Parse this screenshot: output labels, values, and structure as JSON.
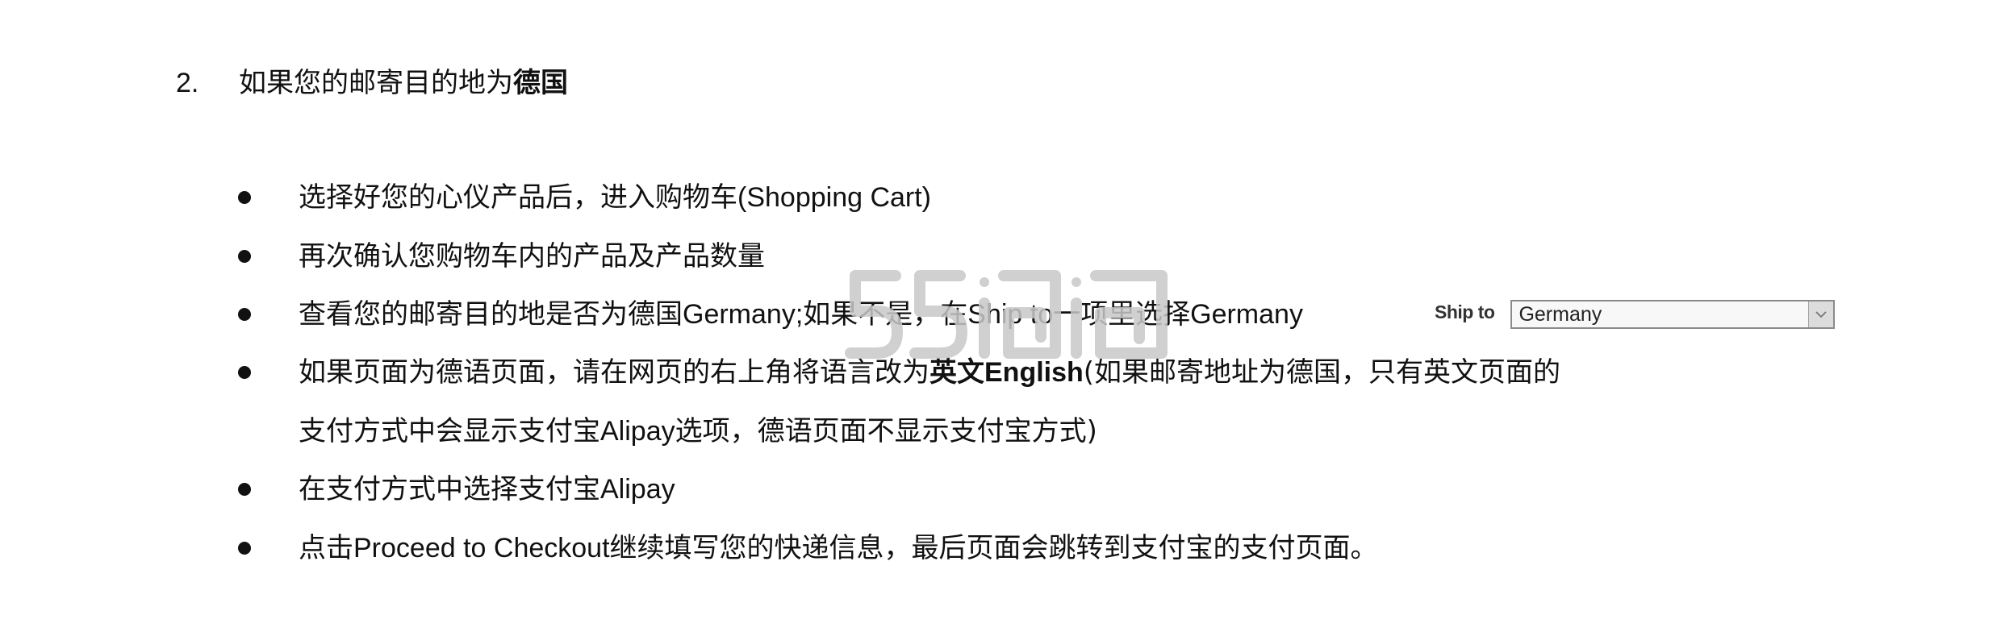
{
  "heading": {
    "number": "2.",
    "text_plain": "如果您的邮寄目的地为",
    "text_bold": "德国"
  },
  "bullets": [
    {
      "segments": [
        {
          "text": "选择好您的心仪产品后，进入购物车",
          "bold": false
        },
        {
          "text": "(Shopping Cart)",
          "bold": false,
          "latin": true
        }
      ]
    },
    {
      "segments": [
        {
          "text": "再次确认您购物车内的产品及产品数量",
          "bold": false
        }
      ]
    },
    {
      "segments": [
        {
          "text": "查看您的邮寄目的地是否为德国 ",
          "bold": false
        },
        {
          "text": "Germany;",
          "bold": false,
          "latin": true
        },
        {
          "text": " 如果不是，在 ",
          "bold": false
        },
        {
          "text": "Ship to",
          "bold": false,
          "latin": true
        },
        {
          "text": " 一项里选择 ",
          "bold": false
        },
        {
          "text": "Germany",
          "bold": false,
          "latin": true
        }
      ]
    },
    {
      "segments": [
        {
          "text": "如果页面为德语页面，请在网页的右上角将语言改为",
          "bold": false
        },
        {
          "text": "英文 ",
          "bold": true
        },
        {
          "text": "English",
          "bold": true,
          "latin": true
        },
        {
          "text": " (如果邮寄地址为德国，只有英文页面的",
          "bold": false
        }
      ],
      "continuation": [
        {
          "text": "支付方式中会显示支付宝 ",
          "bold": false
        },
        {
          "text": "Alipay",
          "bold": false,
          "latin": true
        },
        {
          "text": " 选项，德语页面不显示支付宝方式)",
          "bold": false
        }
      ]
    },
    {
      "segments": [
        {
          "text": "在支付方式中选择支付宝 ",
          "bold": false
        },
        {
          "text": "Alipay",
          "bold": false,
          "latin": true
        }
      ]
    },
    {
      "segments": [
        {
          "text": "点击 ",
          "bold": false
        },
        {
          "text": "Proceed to Checkout",
          "bold": false,
          "latin": true
        },
        {
          "text": " 继续填写您的快递信息，最后页面会跳转到支付宝的支付页面。",
          "bold": false
        }
      ]
    }
  ],
  "ship_to_widget": {
    "label": "Ship to",
    "selected_value": "Germany",
    "arrow_icon": "chevron-down-icon"
  },
  "watermark": {
    "text": "55海淘",
    "color": "#c8c8c8"
  }
}
